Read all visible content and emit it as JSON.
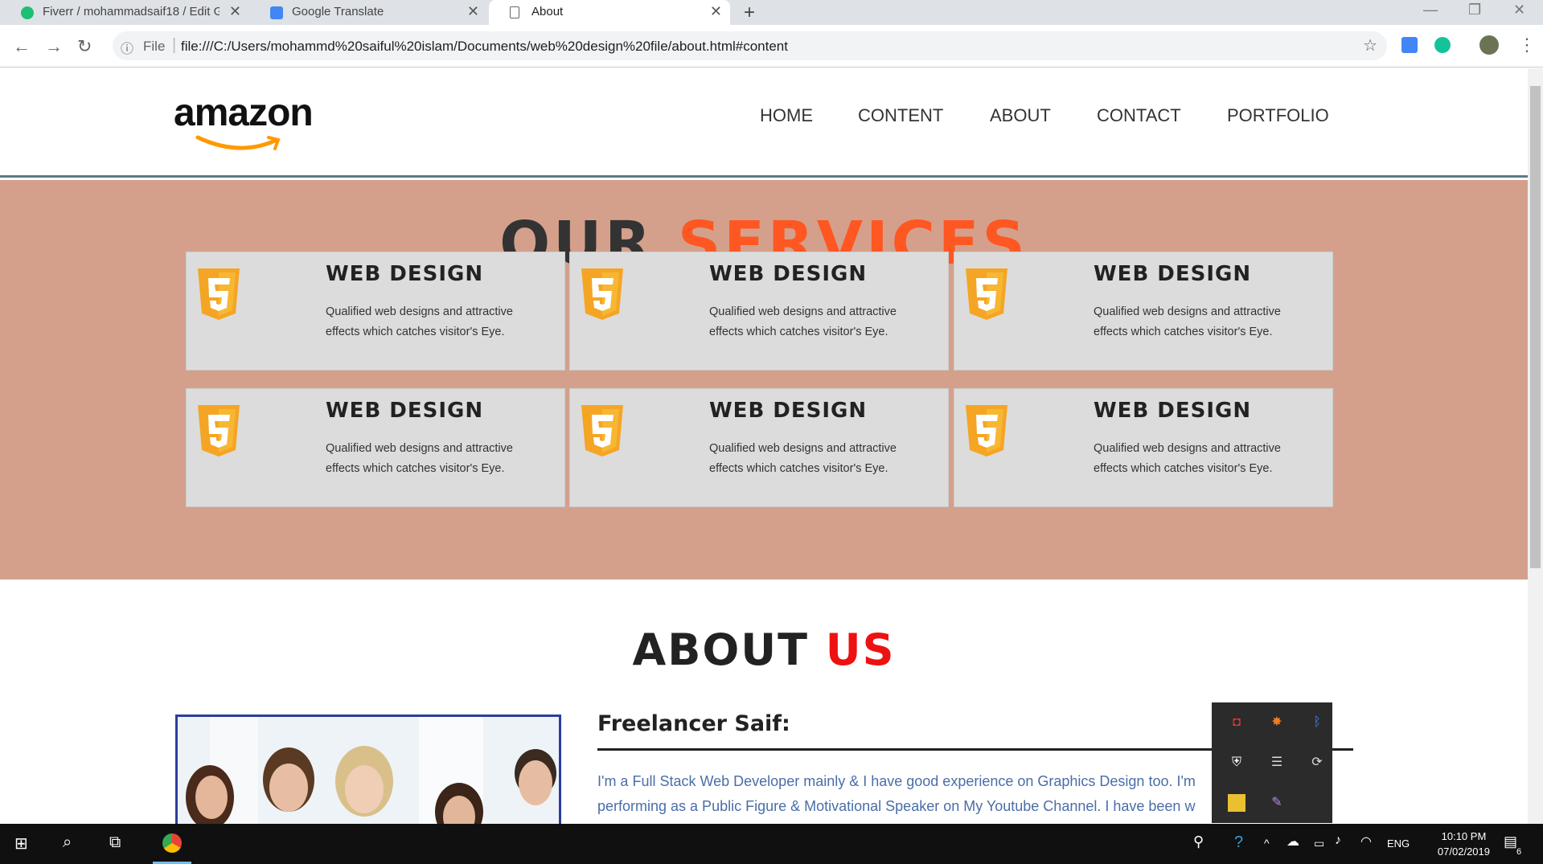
{
  "browser": {
    "tabs": [
      {
        "title": "Fiverr / mohammadsaif18 / Edit G",
        "icon": "fiverr-icon",
        "color": "#1dbf73"
      },
      {
        "title": "Google Translate",
        "icon": "google-translate-icon",
        "color": "#4285f4"
      },
      {
        "title": "About",
        "icon": "document-icon",
        "color": "#555555"
      }
    ],
    "url_scheme": "File",
    "url": "file:///C:/Users/mohammd%20saiful%20islam/Documents/web%20design%20file/about.html#content"
  },
  "site": {
    "logo": "amazon",
    "nav": [
      "HOME",
      "CONTENT",
      "ABOUT",
      "CONTACT",
      "PORTFOLIO"
    ],
    "services": {
      "title_part1": "OUR",
      "title_part2": "SERVICES",
      "title_color1": "#333333",
      "title_color2": "#ff5722",
      "cards": [
        {
          "icon": "html5-icon",
          "title": "WEB DESIGN",
          "desc": "Qualified web designs and attractive effects which catches visitor's Eye."
        },
        {
          "icon": "html5-icon",
          "title": "WEB DESIGN",
          "desc": "Qualified web designs and attractive effects which catches visitor's Eye."
        },
        {
          "icon": "html5-icon",
          "title": "WEB DESIGN",
          "desc": "Qualified web designs and attractive effects which catches visitor's Eye."
        },
        {
          "icon": "html5-icon",
          "title": "WEB DESIGN",
          "desc": "Qualified web designs and attractive effects which catches visitor's Eye."
        },
        {
          "icon": "html5-icon",
          "title": "WEB DESIGN",
          "desc": "Qualified web designs and attractive effects which catches visitor's Eye."
        },
        {
          "icon": "html5-icon",
          "title": "WEB DESIGN",
          "desc": "Qualified web designs and attractive effects which catches visitor's Eye."
        }
      ]
    },
    "about": {
      "title_part1": "ABOUT",
      "title_part2": "US",
      "title_color2": "#ee1111",
      "heading": "Freelancer Saif:",
      "text_line1": "I'm a Full Stack Web Developer mainly & I have good experience on Graphics Design too. I'm",
      "text_line2": "performing as a Public Figure & Motivational Speaker on My Youtube Channel. I have been w"
    }
  },
  "taskbar": {
    "time": "10:10 PM",
    "date": "07/02/2019",
    "lang": "ENG",
    "notification_count": "6"
  }
}
